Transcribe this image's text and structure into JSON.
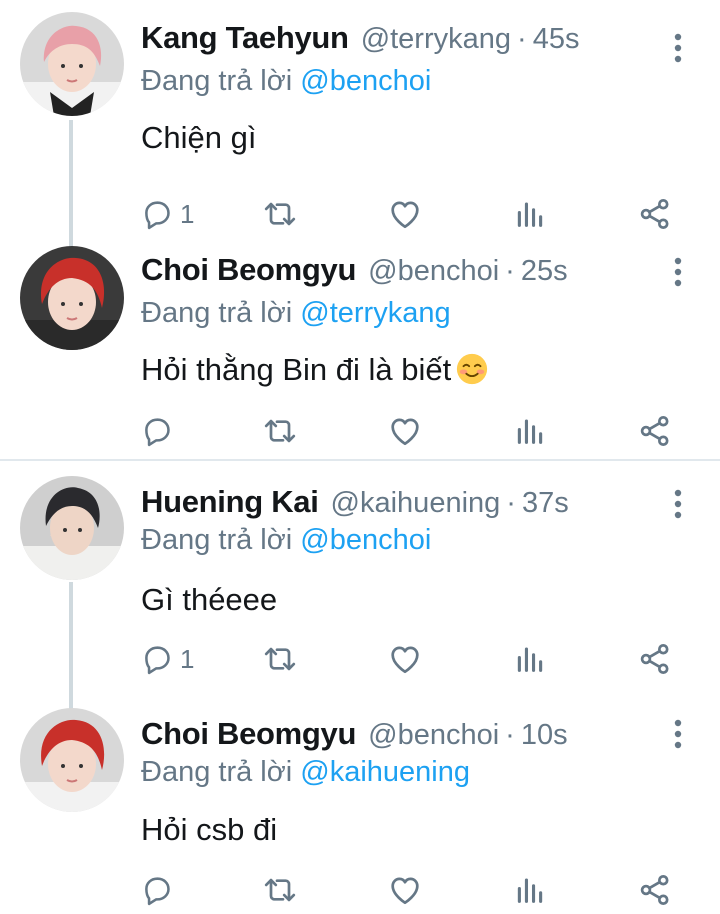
{
  "tweets": [
    {
      "name": "Kang Taehyun",
      "handle": "@terrykang",
      "time": "45s",
      "replying_label": "Đang trả lời",
      "replying_to": "@benchoi",
      "text": "Chiện gì",
      "reply_count": "1",
      "avatar_icon": "avatar-pink-hair",
      "colors": {
        "hair": "#e8a0a8",
        "bg": "#d9d9d9"
      }
    },
    {
      "name": "Choi Beomgyu",
      "handle": "@benchoi",
      "time": "25s",
      "replying_label": "Đang trả lời",
      "replying_to": "@terrykang",
      "text": "Hỏi thằng Bin đi là biết",
      "emoji": "smiling-face-emoji",
      "reply_count": "",
      "avatar_icon": "avatar-red-hair",
      "colors": {
        "hair": "#c8302a",
        "bg": "#3a3a3a"
      }
    },
    {
      "name": "Huening Kai",
      "handle": "@kaihuening",
      "time": "37s",
      "replying_label": "Đang trả lời",
      "replying_to": "@benchoi",
      "text": "Gì théeee",
      "reply_count": "1",
      "avatar_icon": "avatar-dark-hair",
      "colors": {
        "hair": "#2a2a2e",
        "bg": "#cfcfcf"
      }
    },
    {
      "name": "Choi Beomgyu",
      "handle": "@benchoi",
      "time": "10s",
      "replying_label": "Đang trả lời",
      "replying_to": "@kaihuening",
      "text": "Hỏi csb đi",
      "reply_count": "",
      "avatar_icon": "avatar-red-hair",
      "colors": {
        "hair": "#c8302a",
        "bg": "#d8d8d8"
      }
    }
  ],
  "ui_colors": {
    "accent": "#1da1f2",
    "secondary_text": "#657786",
    "icon": "#657786",
    "thread_line": "#cfd9de"
  },
  "action_icons": [
    "reply-icon",
    "retweet-icon",
    "like-icon",
    "analytics-icon",
    "share-icon"
  ]
}
